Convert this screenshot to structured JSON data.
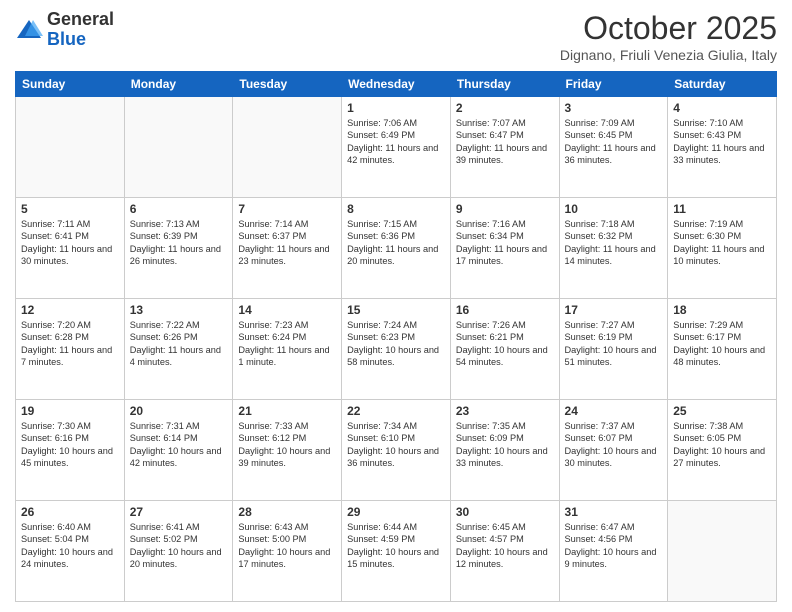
{
  "logo": {
    "general": "General",
    "blue": "Blue"
  },
  "header": {
    "month": "October 2025",
    "location": "Dignano, Friuli Venezia Giulia, Italy"
  },
  "weekdays": [
    "Sunday",
    "Monday",
    "Tuesday",
    "Wednesday",
    "Thursday",
    "Friday",
    "Saturday"
  ],
  "weeks": [
    [
      {
        "day": "",
        "sunrise": "",
        "sunset": "",
        "daylight": ""
      },
      {
        "day": "",
        "sunrise": "",
        "sunset": "",
        "daylight": ""
      },
      {
        "day": "",
        "sunrise": "",
        "sunset": "",
        "daylight": ""
      },
      {
        "day": "1",
        "sunrise": "Sunrise: 7:06 AM",
        "sunset": "Sunset: 6:49 PM",
        "daylight": "Daylight: 11 hours and 42 minutes."
      },
      {
        "day": "2",
        "sunrise": "Sunrise: 7:07 AM",
        "sunset": "Sunset: 6:47 PM",
        "daylight": "Daylight: 11 hours and 39 minutes."
      },
      {
        "day": "3",
        "sunrise": "Sunrise: 7:09 AM",
        "sunset": "Sunset: 6:45 PM",
        "daylight": "Daylight: 11 hours and 36 minutes."
      },
      {
        "day": "4",
        "sunrise": "Sunrise: 7:10 AM",
        "sunset": "Sunset: 6:43 PM",
        "daylight": "Daylight: 11 hours and 33 minutes."
      }
    ],
    [
      {
        "day": "5",
        "sunrise": "Sunrise: 7:11 AM",
        "sunset": "Sunset: 6:41 PM",
        "daylight": "Daylight: 11 hours and 30 minutes."
      },
      {
        "day": "6",
        "sunrise": "Sunrise: 7:13 AM",
        "sunset": "Sunset: 6:39 PM",
        "daylight": "Daylight: 11 hours and 26 minutes."
      },
      {
        "day": "7",
        "sunrise": "Sunrise: 7:14 AM",
        "sunset": "Sunset: 6:37 PM",
        "daylight": "Daylight: 11 hours and 23 minutes."
      },
      {
        "day": "8",
        "sunrise": "Sunrise: 7:15 AM",
        "sunset": "Sunset: 6:36 PM",
        "daylight": "Daylight: 11 hours and 20 minutes."
      },
      {
        "day": "9",
        "sunrise": "Sunrise: 7:16 AM",
        "sunset": "Sunset: 6:34 PM",
        "daylight": "Daylight: 11 hours and 17 minutes."
      },
      {
        "day": "10",
        "sunrise": "Sunrise: 7:18 AM",
        "sunset": "Sunset: 6:32 PM",
        "daylight": "Daylight: 11 hours and 14 minutes."
      },
      {
        "day": "11",
        "sunrise": "Sunrise: 7:19 AM",
        "sunset": "Sunset: 6:30 PM",
        "daylight": "Daylight: 11 hours and 10 minutes."
      }
    ],
    [
      {
        "day": "12",
        "sunrise": "Sunrise: 7:20 AM",
        "sunset": "Sunset: 6:28 PM",
        "daylight": "Daylight: 11 hours and 7 minutes."
      },
      {
        "day": "13",
        "sunrise": "Sunrise: 7:22 AM",
        "sunset": "Sunset: 6:26 PM",
        "daylight": "Daylight: 11 hours and 4 minutes."
      },
      {
        "day": "14",
        "sunrise": "Sunrise: 7:23 AM",
        "sunset": "Sunset: 6:24 PM",
        "daylight": "Daylight: 11 hours and 1 minute."
      },
      {
        "day": "15",
        "sunrise": "Sunrise: 7:24 AM",
        "sunset": "Sunset: 6:23 PM",
        "daylight": "Daylight: 10 hours and 58 minutes."
      },
      {
        "day": "16",
        "sunrise": "Sunrise: 7:26 AM",
        "sunset": "Sunset: 6:21 PM",
        "daylight": "Daylight: 10 hours and 54 minutes."
      },
      {
        "day": "17",
        "sunrise": "Sunrise: 7:27 AM",
        "sunset": "Sunset: 6:19 PM",
        "daylight": "Daylight: 10 hours and 51 minutes."
      },
      {
        "day": "18",
        "sunrise": "Sunrise: 7:29 AM",
        "sunset": "Sunset: 6:17 PM",
        "daylight": "Daylight: 10 hours and 48 minutes."
      }
    ],
    [
      {
        "day": "19",
        "sunrise": "Sunrise: 7:30 AM",
        "sunset": "Sunset: 6:16 PM",
        "daylight": "Daylight: 10 hours and 45 minutes."
      },
      {
        "day": "20",
        "sunrise": "Sunrise: 7:31 AM",
        "sunset": "Sunset: 6:14 PM",
        "daylight": "Daylight: 10 hours and 42 minutes."
      },
      {
        "day": "21",
        "sunrise": "Sunrise: 7:33 AM",
        "sunset": "Sunset: 6:12 PM",
        "daylight": "Daylight: 10 hours and 39 minutes."
      },
      {
        "day": "22",
        "sunrise": "Sunrise: 7:34 AM",
        "sunset": "Sunset: 6:10 PM",
        "daylight": "Daylight: 10 hours and 36 minutes."
      },
      {
        "day": "23",
        "sunrise": "Sunrise: 7:35 AM",
        "sunset": "Sunset: 6:09 PM",
        "daylight": "Daylight: 10 hours and 33 minutes."
      },
      {
        "day": "24",
        "sunrise": "Sunrise: 7:37 AM",
        "sunset": "Sunset: 6:07 PM",
        "daylight": "Daylight: 10 hours and 30 minutes."
      },
      {
        "day": "25",
        "sunrise": "Sunrise: 7:38 AM",
        "sunset": "Sunset: 6:05 PM",
        "daylight": "Daylight: 10 hours and 27 minutes."
      }
    ],
    [
      {
        "day": "26",
        "sunrise": "Sunrise: 6:40 AM",
        "sunset": "Sunset: 5:04 PM",
        "daylight": "Daylight: 10 hours and 24 minutes."
      },
      {
        "day": "27",
        "sunrise": "Sunrise: 6:41 AM",
        "sunset": "Sunset: 5:02 PM",
        "daylight": "Daylight: 10 hours and 20 minutes."
      },
      {
        "day": "28",
        "sunrise": "Sunrise: 6:43 AM",
        "sunset": "Sunset: 5:00 PM",
        "daylight": "Daylight: 10 hours and 17 minutes."
      },
      {
        "day": "29",
        "sunrise": "Sunrise: 6:44 AM",
        "sunset": "Sunset: 4:59 PM",
        "daylight": "Daylight: 10 hours and 15 minutes."
      },
      {
        "day": "30",
        "sunrise": "Sunrise: 6:45 AM",
        "sunset": "Sunset: 4:57 PM",
        "daylight": "Daylight: 10 hours and 12 minutes."
      },
      {
        "day": "31",
        "sunrise": "Sunrise: 6:47 AM",
        "sunset": "Sunset: 4:56 PM",
        "daylight": "Daylight: 10 hours and 9 minutes."
      },
      {
        "day": "",
        "sunrise": "",
        "sunset": "",
        "daylight": ""
      }
    ]
  ]
}
